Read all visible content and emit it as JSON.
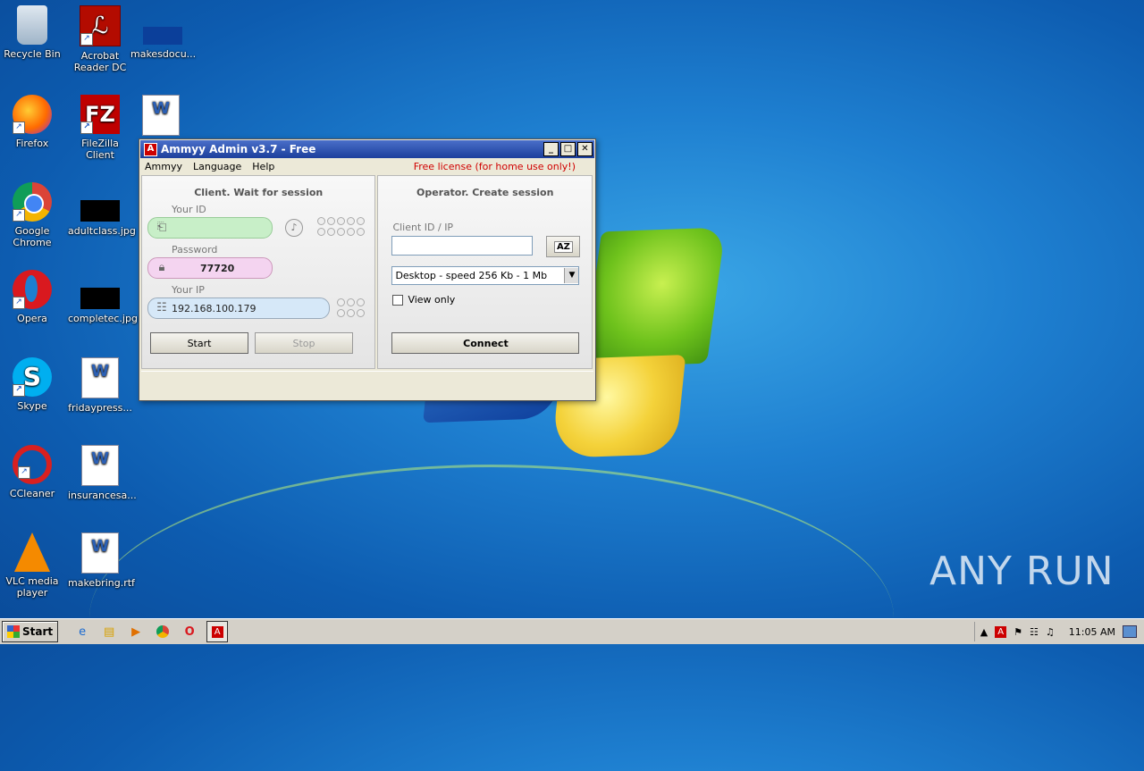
{
  "desktop": {
    "icons": [
      {
        "label": "Recycle Bin",
        "icon": "recycle-bin-icon"
      },
      {
        "label": "Acrobat Reader DC",
        "icon": "acrobat-icon"
      },
      {
        "label": "makesdocu...",
        "icon": "image-file-icon"
      },
      {
        "label": "Firefox",
        "icon": "firefox-icon"
      },
      {
        "label": "FileZilla Client",
        "icon": "filezilla-icon"
      },
      {
        "label": "Google Chrome",
        "icon": "chrome-icon"
      },
      {
        "label": "adultclass.jpg",
        "icon": "image-file-icon"
      },
      {
        "label": "Opera",
        "icon": "opera-icon"
      },
      {
        "label": "completec.jpg",
        "icon": "image-file-icon"
      },
      {
        "label": "Skype",
        "icon": "skype-icon"
      },
      {
        "label": "fridaypress...",
        "icon": "word-doc-icon"
      },
      {
        "label": "CCleaner",
        "icon": "ccleaner-icon"
      },
      {
        "label": "insurancesa...",
        "icon": "word-doc-icon"
      },
      {
        "label": "VLC media player",
        "icon": "vlc-icon"
      },
      {
        "label": "makebring.rtf",
        "icon": "word-doc-icon"
      }
    ]
  },
  "window": {
    "title": "Ammyy Admin v3.7 - Free",
    "menu": [
      "Ammyy",
      "Language",
      "Help"
    ],
    "license_text": "Free license (for home use only!)",
    "client": {
      "heading": "Client. Wait for session",
      "your_id_label": "Your ID",
      "your_id_value": "",
      "password_label": "Password",
      "password_value": "77720",
      "your_ip_label": "Your IP",
      "your_ip_value": "192.168.100.179",
      "start_label": "Start",
      "stop_label": "Stop"
    },
    "operator": {
      "heading": "Operator. Create session",
      "client_id_label": "Client ID / IP",
      "client_id_value": "",
      "az_label": "AZ",
      "speed_selected": "Desktop - speed  256 Kb - 1 Mb",
      "view_only_label": "View only",
      "view_only_checked": false,
      "connect_label": "Connect"
    }
  },
  "taskbar": {
    "start_label": "Start",
    "clock": "11:05 AM"
  },
  "watermark": "ANY RUN",
  "colors": {
    "license_red": "#d00000",
    "id_field": "#c8efc8",
    "password_field": "#f4d4f0",
    "ip_field": "#d6e8f8"
  }
}
